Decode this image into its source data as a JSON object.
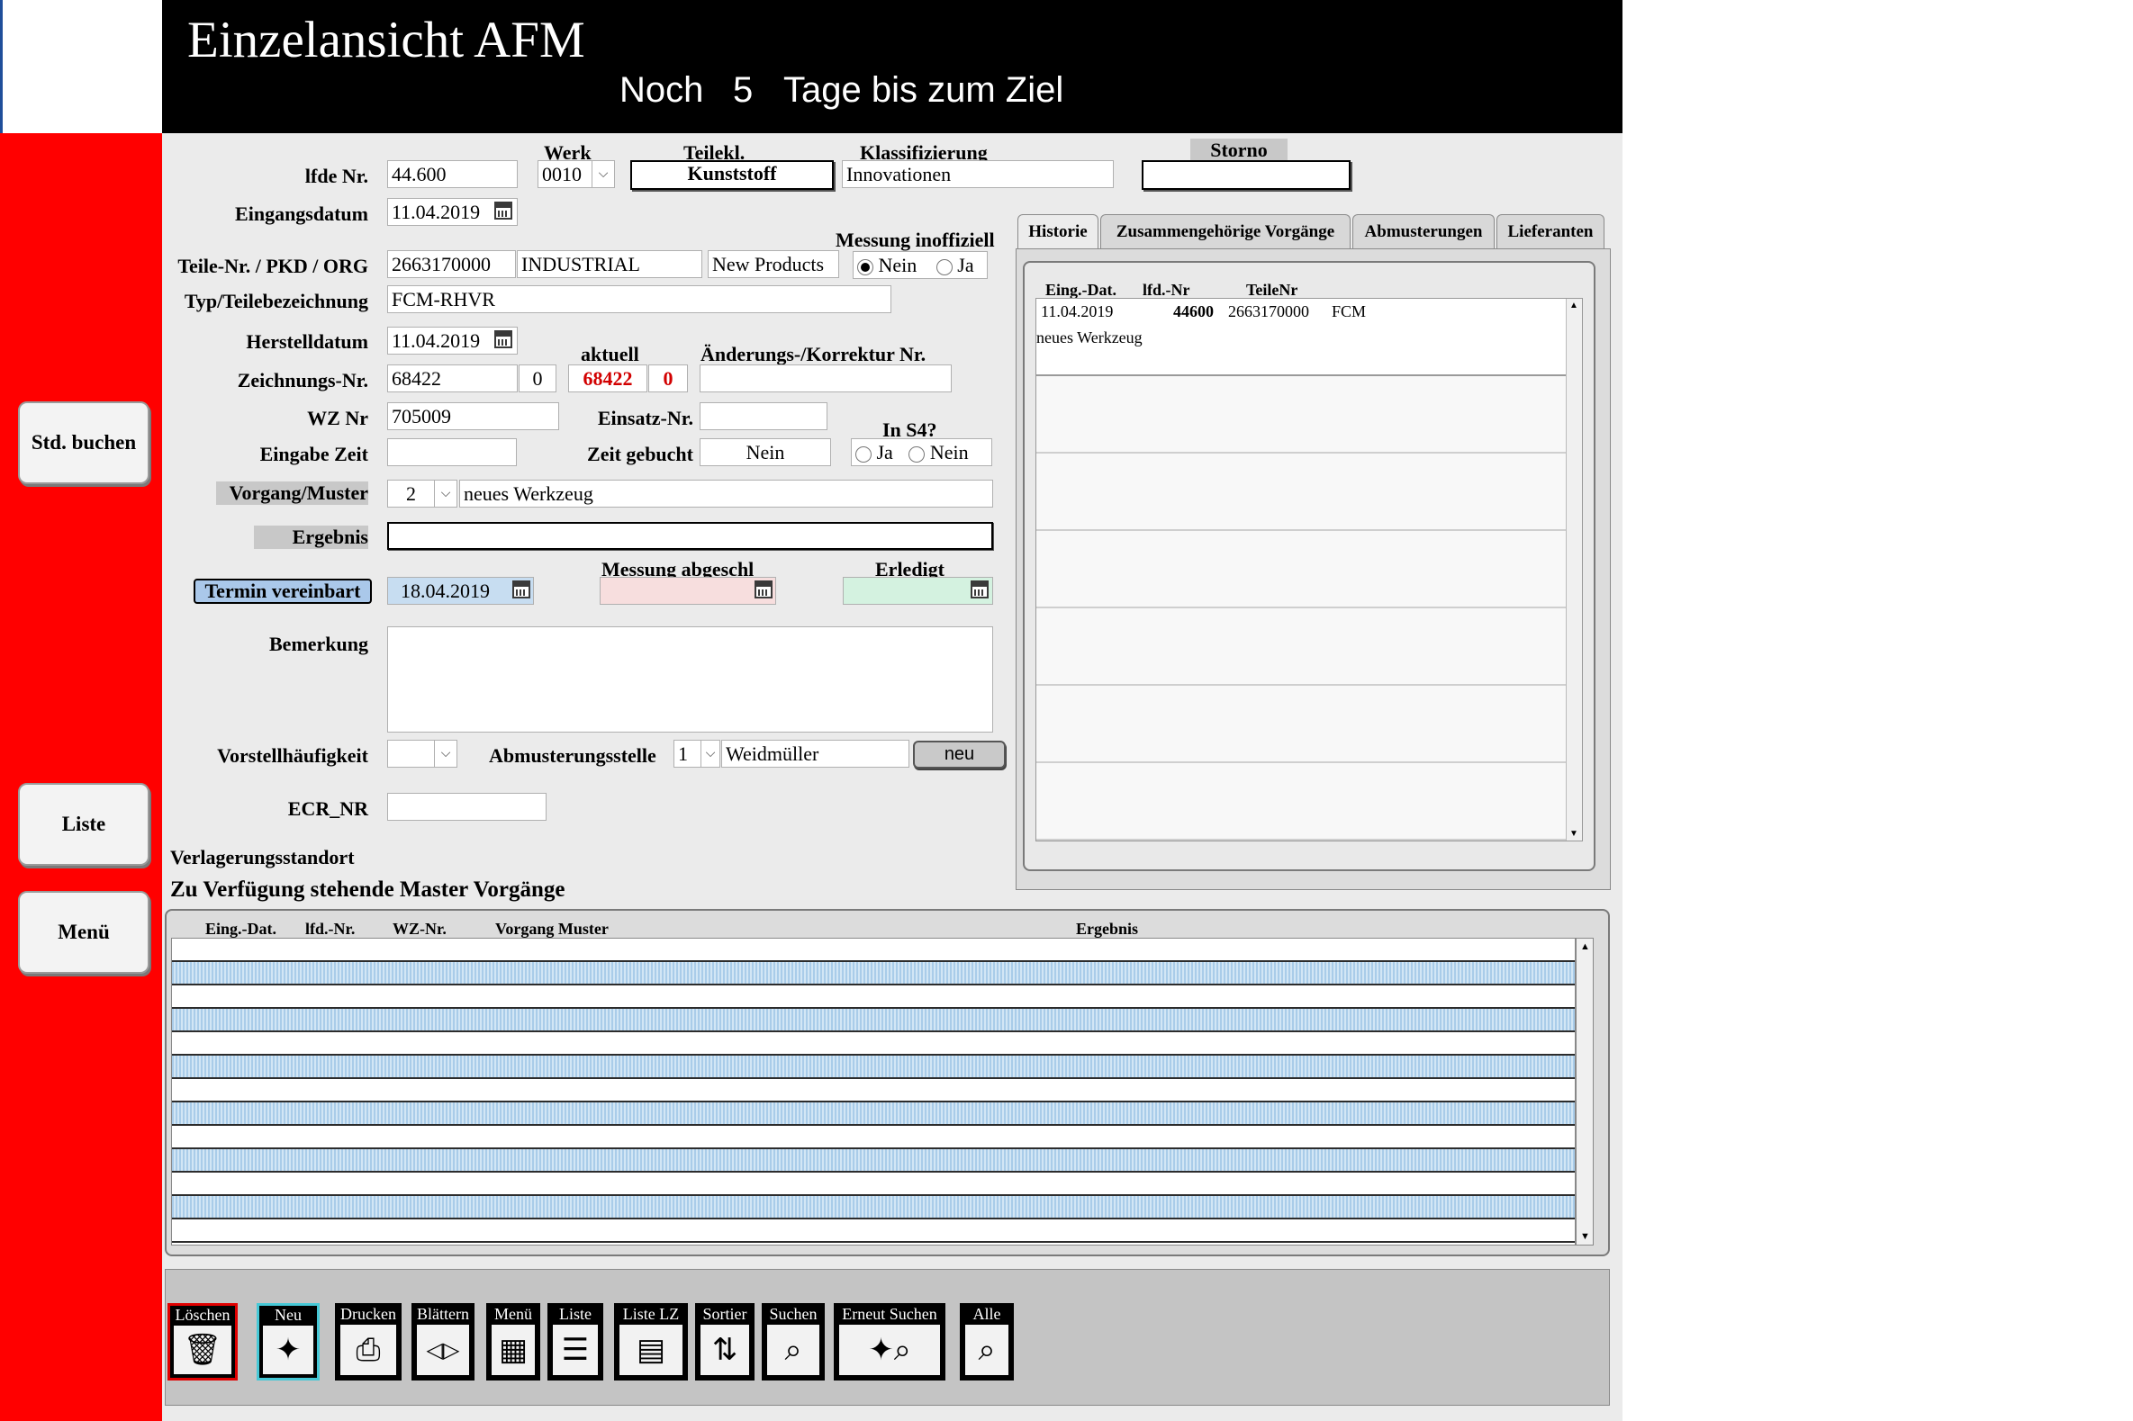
{
  "header": {
    "title": "Einzelansicht AFM",
    "countdown_prefix": "Noch",
    "countdown_days": "5",
    "countdown_suffix": "Tage bis zum Ziel"
  },
  "sidebar": {
    "std_buchen": "Std. buchen",
    "liste": "Liste",
    "menue": "Menü"
  },
  "form": {
    "lfde_nr_label": "lfde Nr.",
    "lfde_nr_value": "44.600",
    "werk_label": "Werk",
    "werk_value": "0010",
    "teilekl_label": "Teilekl.",
    "teilekl_value": "Kunststoff",
    "klassifizierung_label": "Klassifizierung",
    "klassifizierung_value": "Innovationen",
    "storno_label": "Storno",
    "storno_value": "",
    "eingangsdatum_label": "Eingangsdatum",
    "eingangsdatum_value": "11.04.2019",
    "messung_inoffiziell_label": "Messung inoffiziell",
    "opt_nein": "Nein",
    "opt_ja": "Ja",
    "teile_nr_label": "Teile-Nr. / PKD / ORG",
    "teile_nr_value": "2663170000",
    "pkd_value": "INDUSTRIAL",
    "org_value": "New Products",
    "typ_label": "Typ/Teilebezeichnung",
    "typ_value": "FCM-RHVR",
    "herstelldatum_label": "Herstelldatum",
    "herstelldatum_value": "11.04.2019",
    "aktuell_label": "aktuell",
    "aenderungs_label": "Änderungs-/Korrektur Nr.",
    "aenderungs_value": "",
    "zeichnungs_label": "Zeichnungs-Nr.",
    "zeichnungs_value": "68422",
    "zeichnungs_index": "0",
    "aktuell_nr": "68422",
    "aktuell_index": "0",
    "wz_label": "WZ Nr",
    "wz_value": "705009",
    "einsatz_label": "Einsatz-Nr.",
    "einsatz_value": "",
    "in_s4_label": "In S4?",
    "eingabe_zeit_label": "Eingabe Zeit",
    "eingabe_zeit_value": "",
    "zeit_gebucht_label": "Zeit gebucht",
    "zeit_gebucht_value": "Nein",
    "vorgang_label": "Vorgang/Muster",
    "vorgang_nr": "2",
    "vorgang_value": "neues Werkzeug",
    "ergebnis_label": "Ergebnis",
    "ergebnis_value": "",
    "termin_label": "Termin vereinbart",
    "termin_value": "18.04.2019",
    "messung_abgeschl_label": "Messung  abgeschl",
    "messung_abgeschl_value": "",
    "erledigt_label": "Erledigt",
    "erledigt_value": "",
    "bemerkung_label": "Bemerkung",
    "bemerkung_value": "",
    "vorstell_label": "Vorstellhäufigkeit",
    "vorstell_value": "",
    "abmuster_label": "Abmusterungsstelle",
    "abmuster_nr": "1",
    "abmuster_value": "Weidmüller",
    "neu_button": "neu",
    "ecr_label": "ECR_NR",
    "ecr_value": "",
    "verlagerung_label": "Verlagerungsstandort"
  },
  "tabs": [
    "Historie",
    "Zusammengehörige Vorgänge",
    "Abmusterungen",
    "Lieferanten"
  ],
  "historie": {
    "columns": [
      "Eing.-Dat.",
      "lfd.-Nr",
      "TeileNr"
    ],
    "row1_date": "11.04.2019",
    "row1_nr": "44600",
    "row1_teil": "2663170000",
    "row1_extra": "FCM",
    "row1_text": "neues Werkzeug"
  },
  "master": {
    "title": "Zu Verfügung stehende Master Vorgänge",
    "columns": [
      "Eing.-Dat.",
      "lfd.-Nr.",
      "WZ-Nr.",
      "Vorgang Muster",
      "Ergebnis"
    ]
  },
  "toolbar": {
    "loeschen": "Löschen",
    "neu": "Neu",
    "drucken": "Drucken",
    "blaettern": "Blättern",
    "menue": "Menü",
    "liste": "Liste",
    "liste_lz": "Liste  LZ",
    "sortier": "Sortier",
    "suchen": "Suchen",
    "erneut_suchen": "Erneut Suchen",
    "alle": "Alle"
  },
  "colors": {
    "sidebar_red": "#ff0000",
    "header_black": "#000000",
    "form_bg": "#ebebeb",
    "accent_red": "#d20000",
    "termin_blue": "#aac8ea",
    "messung_pink": "#f7dede",
    "erledigt_green": "#d4f2e0",
    "row_blue": "#c4def2"
  }
}
